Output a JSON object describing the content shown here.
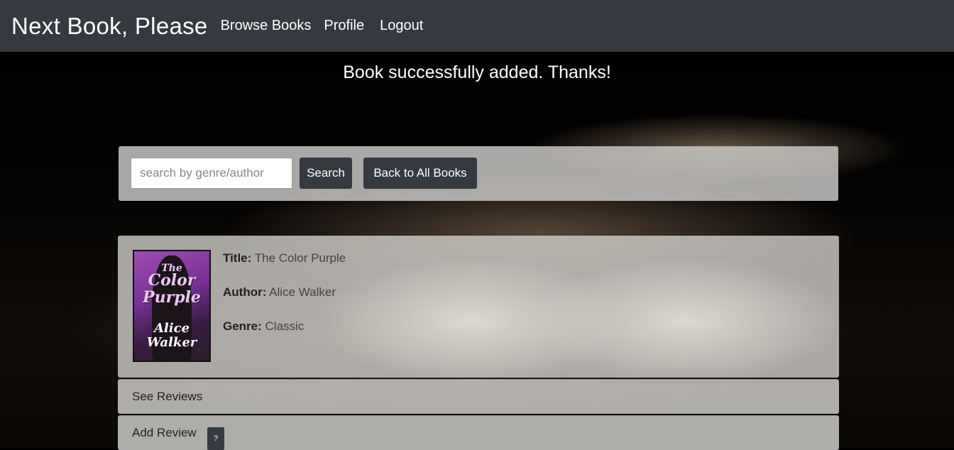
{
  "navbar": {
    "brand": "Next Book, Please",
    "links": [
      "Browse Books",
      "Profile",
      "Logout"
    ]
  },
  "flash_message": "Book successfully added. Thanks!",
  "search": {
    "placeholder": "search by genre/author",
    "search_button": "Search",
    "back_button": "Back to All Books"
  },
  "book": {
    "title_label": "Title:",
    "title": "The Color Purple",
    "author_label": "Author:",
    "author": "Alice Walker",
    "genre_label": "Genre:",
    "genre": "Classic",
    "cover": {
      "line1": "The",
      "line2": "Color",
      "line3": "Purple",
      "author_first": "Alice",
      "author_last": "Walker"
    }
  },
  "accordion": {
    "see_reviews": "See Reviews",
    "add_review": "Add Review",
    "help_badge": "?"
  },
  "colors": {
    "navbar": "#343a40",
    "button": "#343a40"
  }
}
